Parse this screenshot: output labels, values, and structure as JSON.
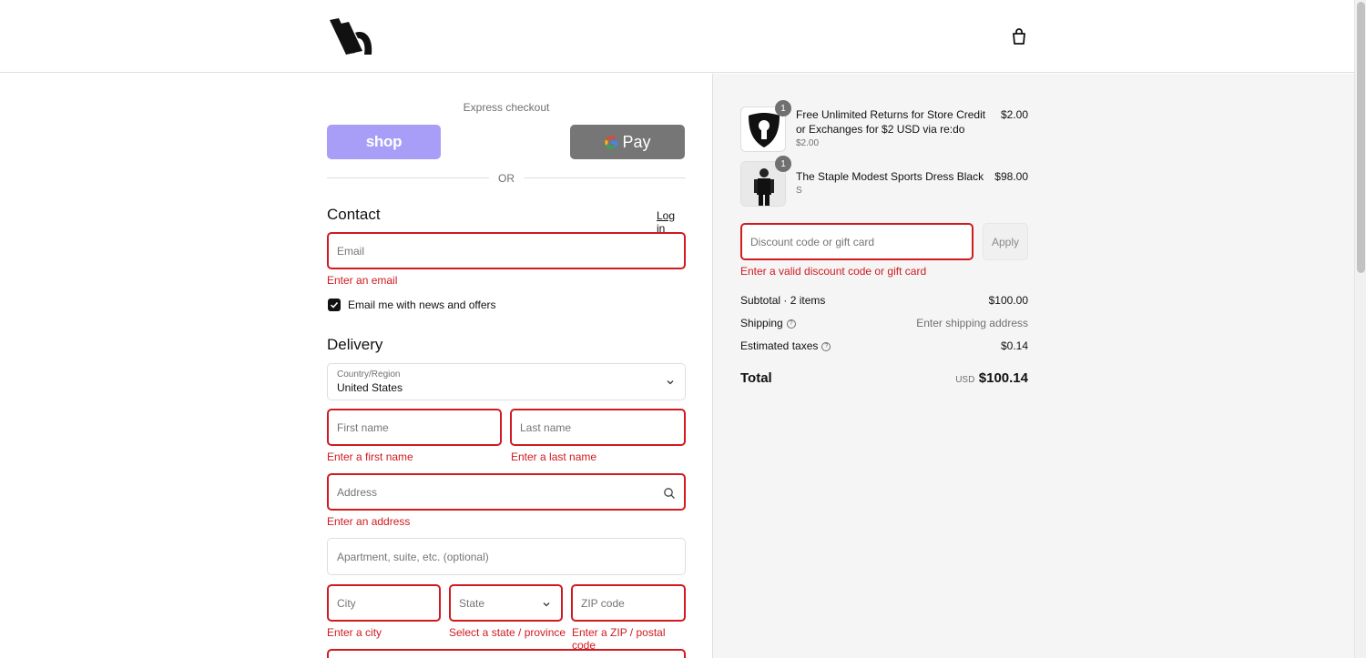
{
  "express": {
    "label": "Express checkout",
    "shop_label": "shop",
    "gpay_label": "Pay"
  },
  "divider": {
    "or_label": "OR"
  },
  "contact": {
    "title": "Contact",
    "login_label": "Log in",
    "email_placeholder": "Email",
    "email_error": "Enter an email",
    "newsletter_label": "Email me with news and offers",
    "newsletter_checked": true
  },
  "delivery": {
    "title": "Delivery",
    "country_label": "Country/Region",
    "country_value": "United States",
    "first_name_placeholder": "First name",
    "first_name_error": "Enter a first name",
    "last_name_placeholder": "Last name",
    "last_name_error": "Enter a last name",
    "address_placeholder": "Address",
    "address_error": "Enter an address",
    "apartment_placeholder": "Apartment, suite, etc. (optional)",
    "city_placeholder": "City",
    "city_error": "Enter a city",
    "state_placeholder": "State",
    "state_error": "Select a state / province",
    "zip_placeholder": "ZIP code",
    "zip_error": "Enter a ZIP / postal code"
  },
  "order": {
    "items": [
      {
        "title": "Free Unlimited Returns for Store Credit or Exchanges for $2 USD via re:do",
        "subtitle": "$2.00",
        "price": "$2.00",
        "quantity": "1",
        "icon": "keyhole-shield-icon"
      },
      {
        "title": "The Staple Modest Sports Dress Black",
        "subtitle": "S",
        "price": "$98.00",
        "quantity": "1",
        "icon": "product-photo"
      }
    ],
    "discount_placeholder": "Discount code or gift card",
    "discount_error": "Enter a valid discount code or gift card",
    "apply_label": "Apply",
    "subtotal_label": "Subtotal · 2 items",
    "subtotal_value": "$100.00",
    "shipping_label": "Shipping",
    "shipping_value": "Enter shipping address",
    "taxes_label": "Estimated taxes",
    "taxes_value": "$0.14",
    "help_icon": "?",
    "total_label": "Total",
    "total_currency": "USD",
    "total_value": "$100.14"
  },
  "colors": {
    "error": "#d01a1f",
    "shop_pay": "#a89ef7",
    "gpay": "#767676",
    "summary_bg": "#f5f5f5"
  }
}
